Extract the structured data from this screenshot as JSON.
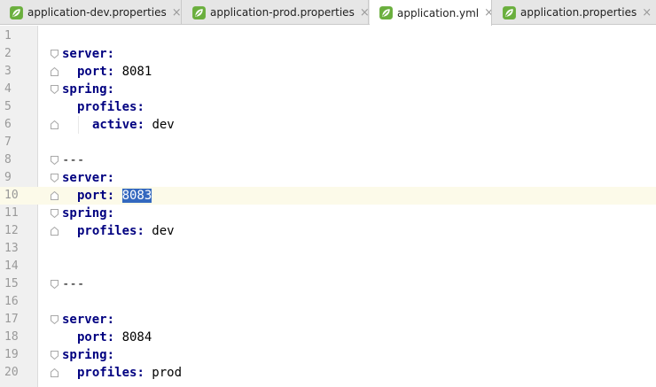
{
  "tabs": [
    {
      "label": "application-dev.properties",
      "close": "×",
      "active": false
    },
    {
      "label": "application-prod.properties",
      "close": "×",
      "active": false
    },
    {
      "label": "application.yml",
      "close": "×",
      "active": true
    },
    {
      "label": "application.properties",
      "close": "×",
      "active": false
    }
  ],
  "colors": {
    "key": "#000080",
    "selection": "#3368bf",
    "current_line": "#fcfae9",
    "gutter": "#f0f0f0",
    "spring_icon": "#6aaf3d"
  },
  "editor": {
    "current_line": 10,
    "lines": [
      {
        "n": "1",
        "key": "",
        "sep": "",
        "val": ""
      },
      {
        "n": "2",
        "key": "server",
        "sep": ":",
        "val": ""
      },
      {
        "n": "3",
        "key": "port",
        "sep": ": ",
        "val": "8081"
      },
      {
        "n": "4",
        "key": "spring",
        "sep": ":",
        "val": ""
      },
      {
        "n": "5",
        "key": "profiles",
        "sep": ":",
        "val": ""
      },
      {
        "n": "6",
        "key": "active",
        "sep": ": ",
        "val": "dev"
      },
      {
        "n": "7",
        "key": "",
        "sep": "",
        "val": ""
      },
      {
        "n": "8",
        "key": "",
        "sep": "",
        "val": "---"
      },
      {
        "n": "9",
        "key": "server",
        "sep": ":",
        "val": ""
      },
      {
        "n": "10",
        "key": "port",
        "sep": ": ",
        "val": "8083"
      },
      {
        "n": "11",
        "key": "spring",
        "sep": ":",
        "val": ""
      },
      {
        "n": "12",
        "key": "profiles",
        "sep": ": ",
        "val": "dev"
      },
      {
        "n": "13",
        "key": "",
        "sep": "",
        "val": ""
      },
      {
        "n": "14",
        "key": "",
        "sep": "",
        "val": ""
      },
      {
        "n": "15",
        "key": "",
        "sep": "",
        "val": "---"
      },
      {
        "n": "16",
        "key": "",
        "sep": "",
        "val": ""
      },
      {
        "n": "17",
        "key": "server",
        "sep": ":",
        "val": ""
      },
      {
        "n": "18",
        "key": "port",
        "sep": ": ",
        "val": "8084"
      },
      {
        "n": "19",
        "key": "spring",
        "sep": ":",
        "val": ""
      },
      {
        "n": "20",
        "key": "profiles",
        "sep": ": ",
        "val": "prod"
      }
    ]
  }
}
